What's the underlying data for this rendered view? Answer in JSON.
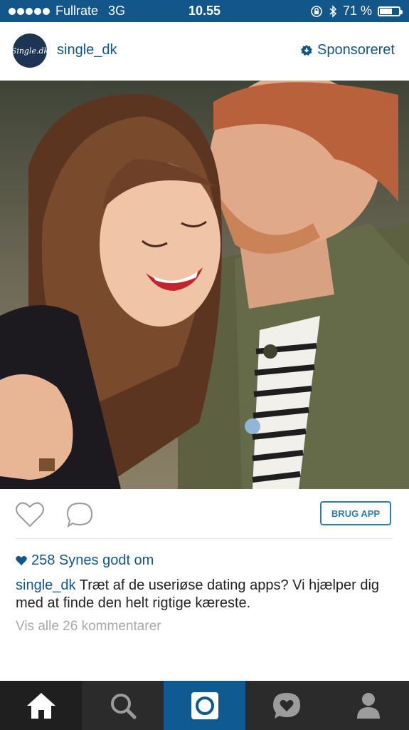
{
  "status_bar": {
    "carrier": "Fullrate",
    "network": "3G",
    "time": "10.55",
    "battery_percent": "71 %",
    "battery_level": 0.71
  },
  "post": {
    "username": "single_dk",
    "avatar_text": "Single.dk",
    "sponsored_label": "Sponsoreret",
    "cta_label": "BRUG APP",
    "likes_text": "258 Synes godt om",
    "caption_user": "single_dk",
    "caption_text": "Træt af de useriøse dating apps? Vi hjælper dig med at finde den helt rigtige kæreste.",
    "view_comments": "Vis alle 26 kommentarer"
  },
  "colors": {
    "brand_blue": "#125688",
    "status_bar": "#12568a",
    "nav_bg": "#2b2b2b",
    "nav_active": "#0f5a91"
  },
  "nav": {
    "items": [
      "home-icon",
      "search-icon",
      "camera-icon",
      "activity-icon",
      "profile-icon"
    ]
  }
}
